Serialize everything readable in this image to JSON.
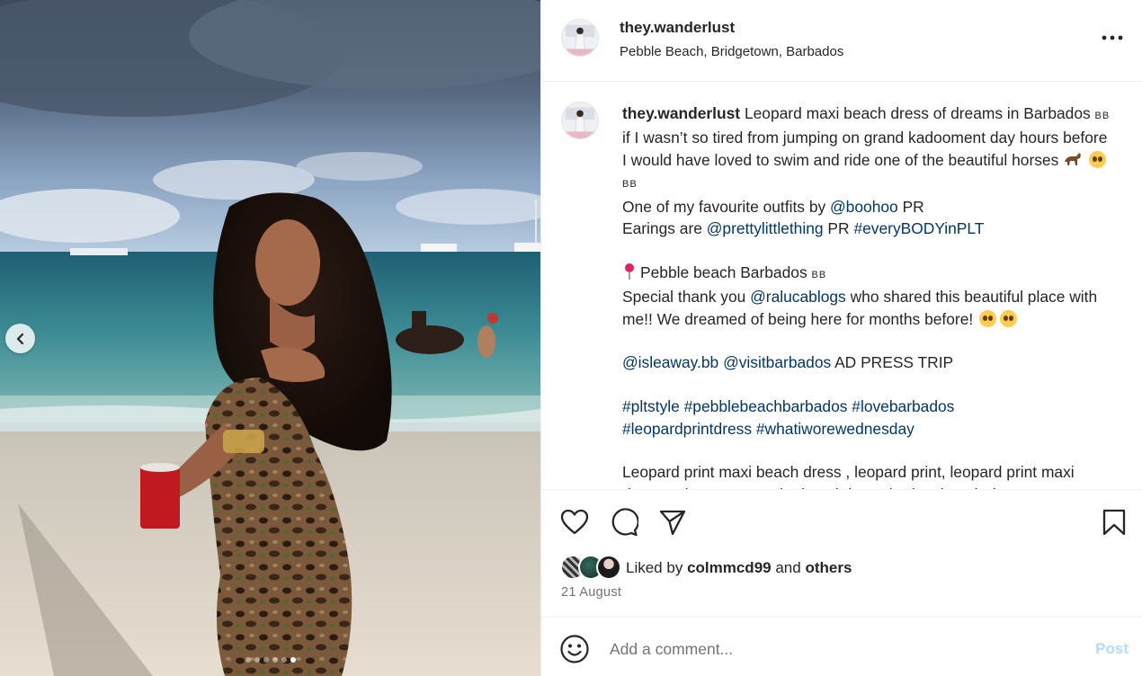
{
  "post": {
    "username": "they.wanderlust",
    "location": "Pebble Beach, Bridgetown, Barbados",
    "liked_by_prefix": "Liked by",
    "liked_by_user": "colmmcd99",
    "liked_by_and": "and",
    "liked_by_others": "others",
    "date": "21 August",
    "carousel": {
      "total_images": 6,
      "active_index": 5
    }
  },
  "caption": {
    "username": "they.wanderlust",
    "p1_text": "Leopard maxi beach dress of dreams in Barbados",
    "flag_code": "BB",
    "p1_text2": "if I wasn’t so tired from jumping on grand kadooment day hours before I would have loved to swim and ride one of the beautiful horses",
    "line2_prefix": "One of my favourite outfits by",
    "line2_mention": "@boohoo",
    "line2_suffix": "PR",
    "line3_prefix": "Earings are",
    "line3_mention": "@prettylittlething",
    "line3_mid": "PR",
    "line3_tag": "#everyBODYinPLT",
    "line4_text": "Pebble beach Barbados",
    "line5_prefix": "Special thank you",
    "line5_mention": "@ralucablogs",
    "line5_suffix": "who shared this beautiful place with me!! We dreamed of being here for months before!",
    "line6_mention1": "@isleaway.bb",
    "line6_mention2": "@visitbarbados",
    "line6_suffix": "AD PRESS TRIP",
    "tags": [
      "#pltstyle",
      "#pebblebeachbarbados",
      "#lovebarbados",
      "#leopardprintdress",
      "#whatiworewednesday"
    ],
    "line8_text": "Leopard print maxi beach dress , leopard print, leopard print maxi dress , what I wore to the beach in Barbados, beach dress"
  },
  "comment_box": {
    "placeholder": "Add a comment...",
    "post_label": "Post"
  },
  "icons": {
    "more": "more-options-icon",
    "like": "heart-icon",
    "comment": "comment-bubble-icon",
    "share": "paper-plane-icon",
    "save": "bookmark-icon",
    "emoji": "smiley-icon",
    "carousel_prev": "chevron-left-icon"
  },
  "colors": {
    "link": "#00376b",
    "post_button_disabled": "#b3dbff",
    "secondary_text": "#737373",
    "divider": "#efefef"
  }
}
